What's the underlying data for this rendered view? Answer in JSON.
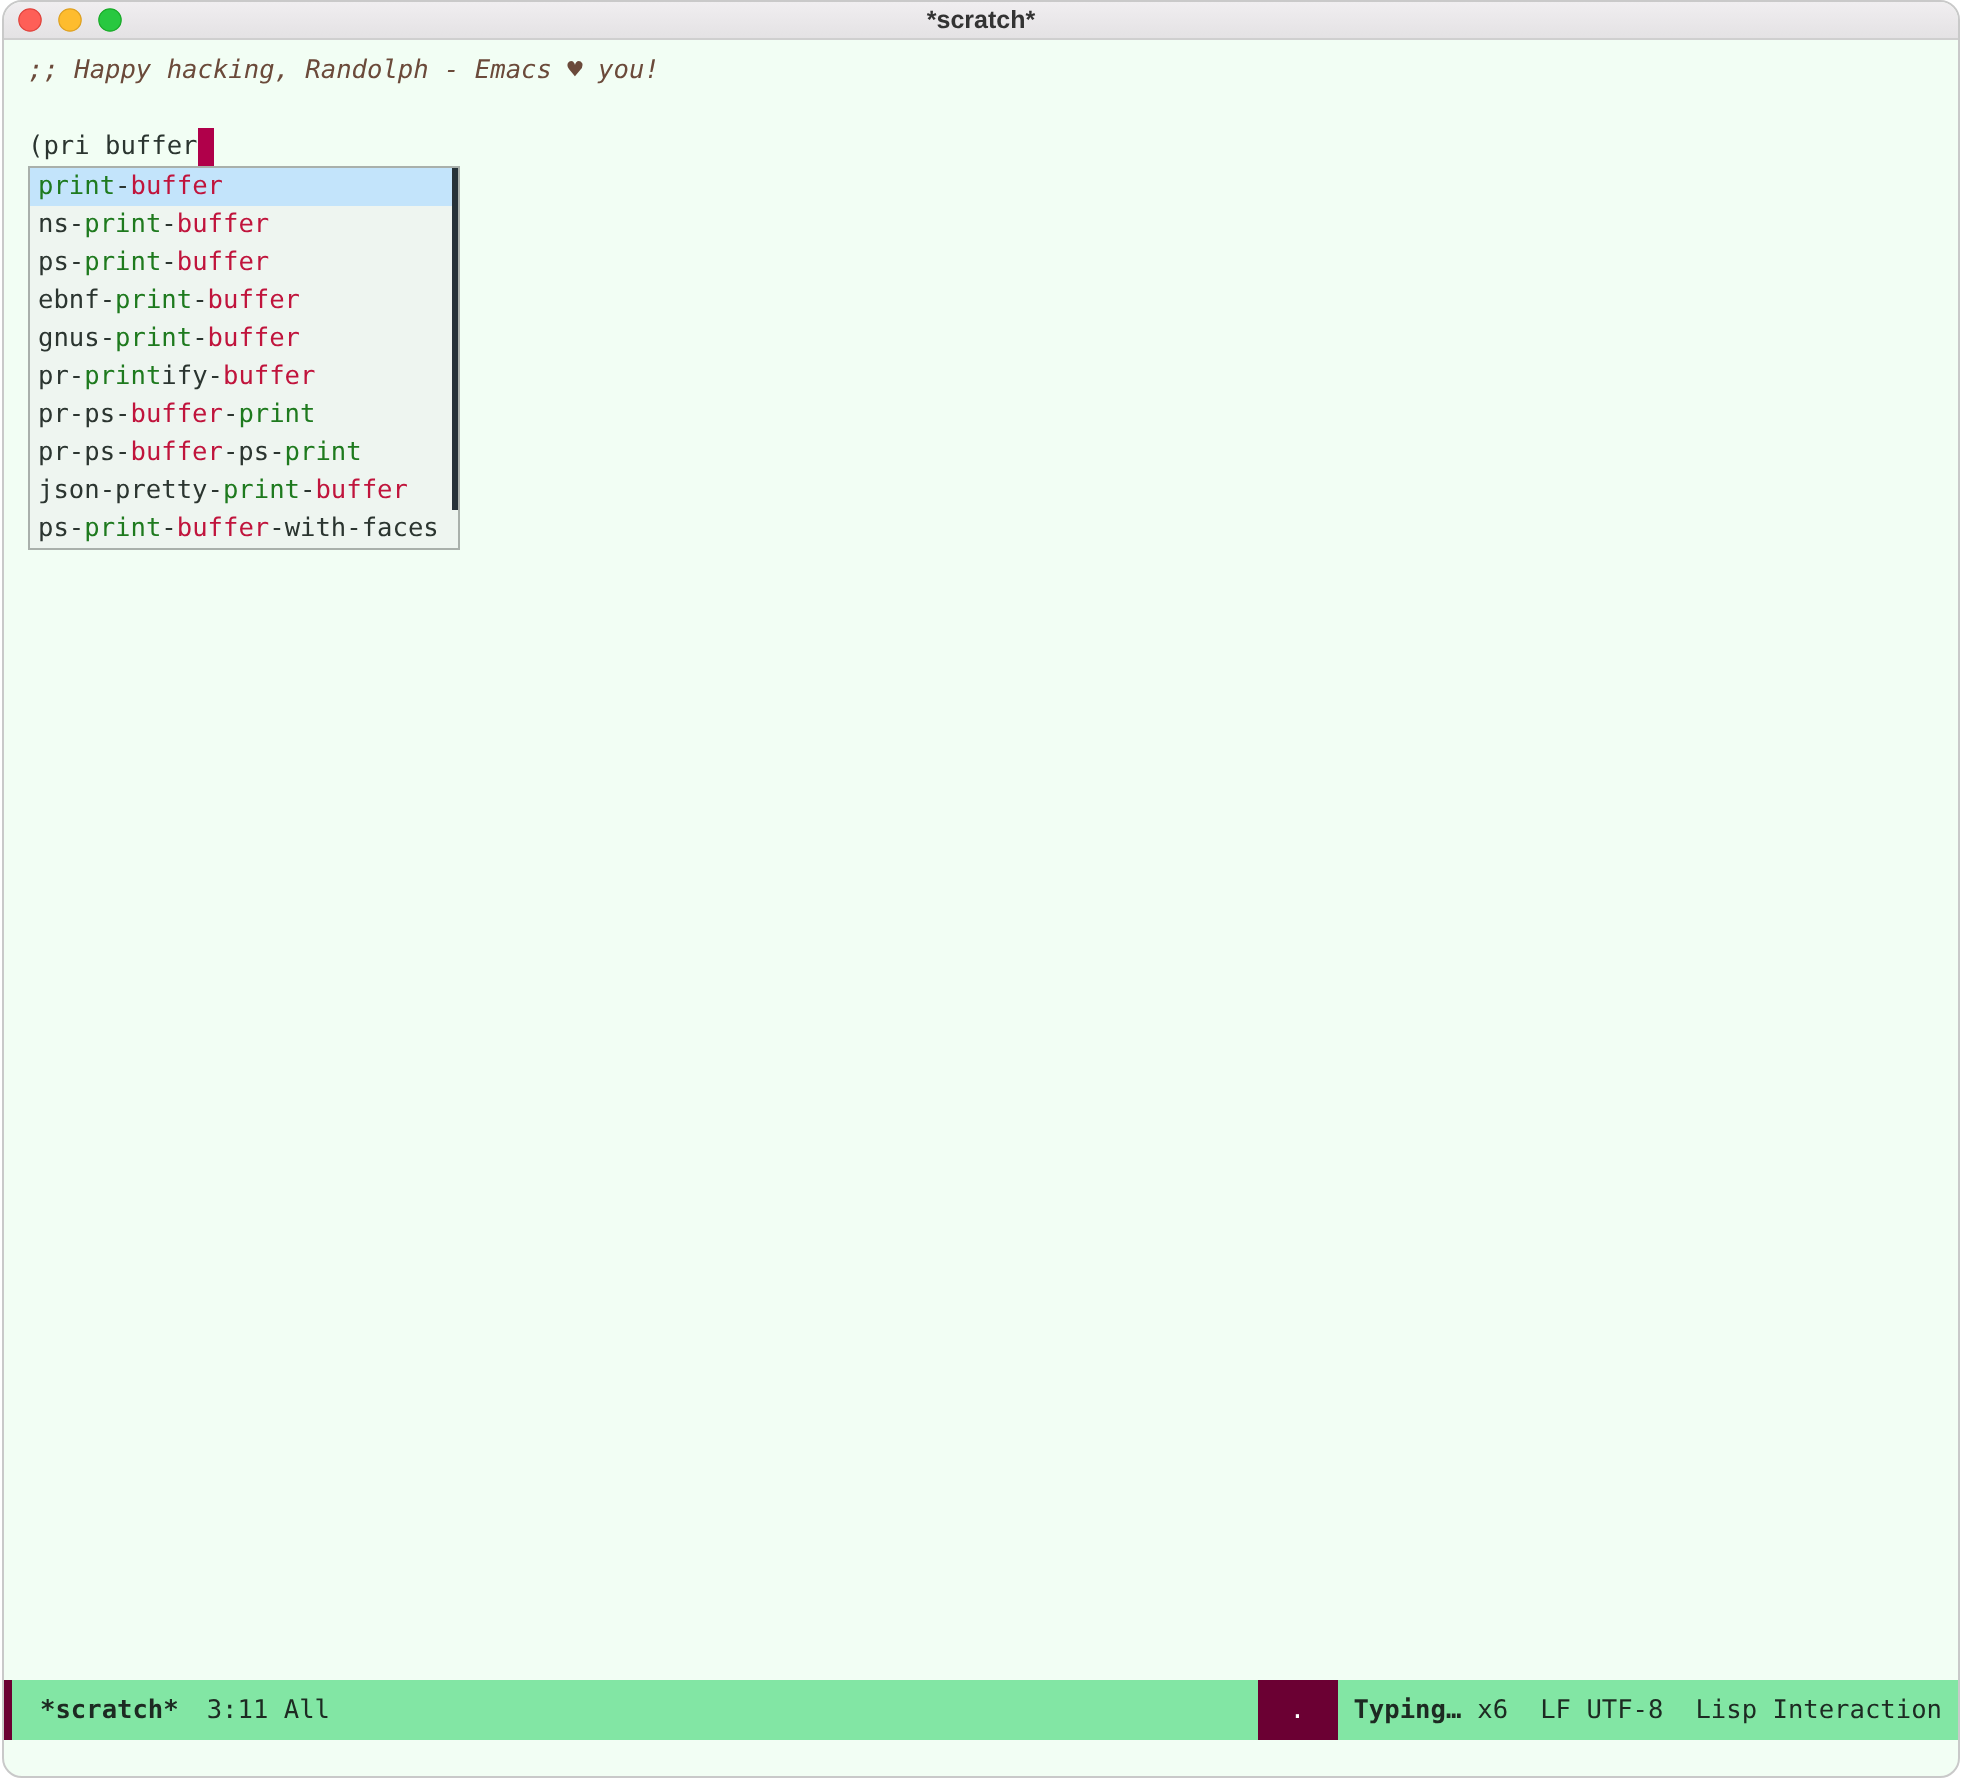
{
  "window": {
    "title": "*scratch*"
  },
  "buffer": {
    "comment": ";; Happy hacking, Randolph - Emacs ♥ you!",
    "input": "(pri buffer"
  },
  "completions": [
    {
      "selected": true,
      "segments": [
        {
          "text": "print",
          "kind": "primary"
        },
        {
          "text": "-",
          "kind": "plain"
        },
        {
          "text": "buffer",
          "kind": "secondary"
        }
      ]
    },
    {
      "selected": false,
      "segments": [
        {
          "text": "ns-",
          "kind": "plain"
        },
        {
          "text": "print",
          "kind": "primary"
        },
        {
          "text": "-",
          "kind": "plain"
        },
        {
          "text": "buffer",
          "kind": "secondary"
        }
      ]
    },
    {
      "selected": false,
      "segments": [
        {
          "text": "ps-",
          "kind": "plain"
        },
        {
          "text": "print",
          "kind": "primary"
        },
        {
          "text": "-",
          "kind": "plain"
        },
        {
          "text": "buffer",
          "kind": "secondary"
        }
      ]
    },
    {
      "selected": false,
      "segments": [
        {
          "text": "ebnf-",
          "kind": "plain"
        },
        {
          "text": "print",
          "kind": "primary"
        },
        {
          "text": "-",
          "kind": "plain"
        },
        {
          "text": "buffer",
          "kind": "secondary"
        }
      ]
    },
    {
      "selected": false,
      "segments": [
        {
          "text": "gnus-",
          "kind": "plain"
        },
        {
          "text": "print",
          "kind": "primary"
        },
        {
          "text": "-",
          "kind": "plain"
        },
        {
          "text": "buffer",
          "kind": "secondary"
        }
      ]
    },
    {
      "selected": false,
      "segments": [
        {
          "text": "pr-",
          "kind": "plain"
        },
        {
          "text": "print",
          "kind": "primary"
        },
        {
          "text": "ify-",
          "kind": "plain"
        },
        {
          "text": "buffer",
          "kind": "secondary"
        }
      ]
    },
    {
      "selected": false,
      "segments": [
        {
          "text": "pr-ps-",
          "kind": "plain"
        },
        {
          "text": "buffer",
          "kind": "secondary"
        },
        {
          "text": "-",
          "kind": "plain"
        },
        {
          "text": "print",
          "kind": "primary"
        }
      ]
    },
    {
      "selected": false,
      "segments": [
        {
          "text": "pr-ps-",
          "kind": "plain"
        },
        {
          "text": "buffer",
          "kind": "secondary"
        },
        {
          "text": "-ps-",
          "kind": "plain"
        },
        {
          "text": "print",
          "kind": "primary"
        }
      ]
    },
    {
      "selected": false,
      "segments": [
        {
          "text": "json-pretty-",
          "kind": "plain"
        },
        {
          "text": "print",
          "kind": "primary"
        },
        {
          "text": "-",
          "kind": "plain"
        },
        {
          "text": "buffer",
          "kind": "secondary"
        }
      ]
    },
    {
      "selected": false,
      "segments": [
        {
          "text": "ps-",
          "kind": "plain"
        },
        {
          "text": "print",
          "kind": "primary"
        },
        {
          "text": "-",
          "kind": "plain"
        },
        {
          "text": "buffer",
          "kind": "secondary"
        },
        {
          "text": "-with-faces",
          "kind": "plain"
        }
      ]
    }
  ],
  "mode_line": {
    "buffer_name": "*scratch*",
    "position": "3:11 All",
    "indicator": ".",
    "status": "Typing…",
    "count": "x6",
    "encoding": "LF UTF-8",
    "mode": "Lisp Interaction"
  }
}
